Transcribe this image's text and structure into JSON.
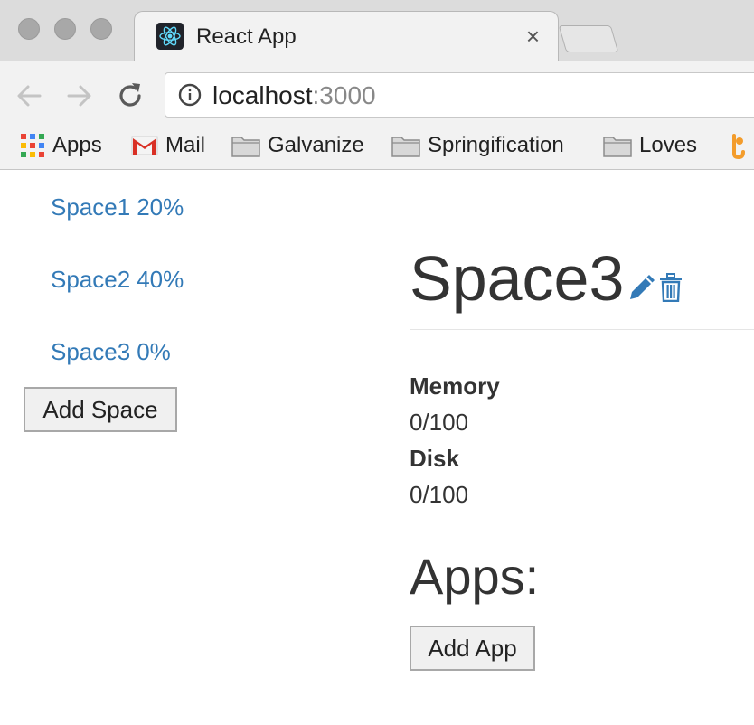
{
  "browser": {
    "tab": {
      "title": "React App",
      "close_glyph": "×",
      "icon": "react-logo-icon"
    },
    "address_bar": {
      "host": "localhost",
      "port": ":3000"
    },
    "bookmarks": [
      {
        "label": "Apps",
        "icon": "apps-grid-icon"
      },
      {
        "label": "Mail",
        "icon": "gmail-icon"
      },
      {
        "label": "Galvanize",
        "icon": "folder-icon"
      },
      {
        "label": "Springification",
        "icon": "folder-icon"
      },
      {
        "label": "Loves",
        "icon": "folder-icon"
      }
    ]
  },
  "sidebar": {
    "spaces": [
      {
        "name": "Space1",
        "percent": "20%"
      },
      {
        "name": "Space2",
        "percent": "40%"
      },
      {
        "name": "Space3",
        "percent": "0%"
      }
    ],
    "add_button": "Add Space"
  },
  "detail": {
    "title": "Space3",
    "memory_label": "Memory",
    "memory_value": "0/100",
    "disk_label": "Disk",
    "disk_value": "0/100",
    "apps_heading": "Apps:",
    "add_app_button": "Add App"
  },
  "colors": {
    "link": "#337ab7",
    "text": "#333333"
  }
}
